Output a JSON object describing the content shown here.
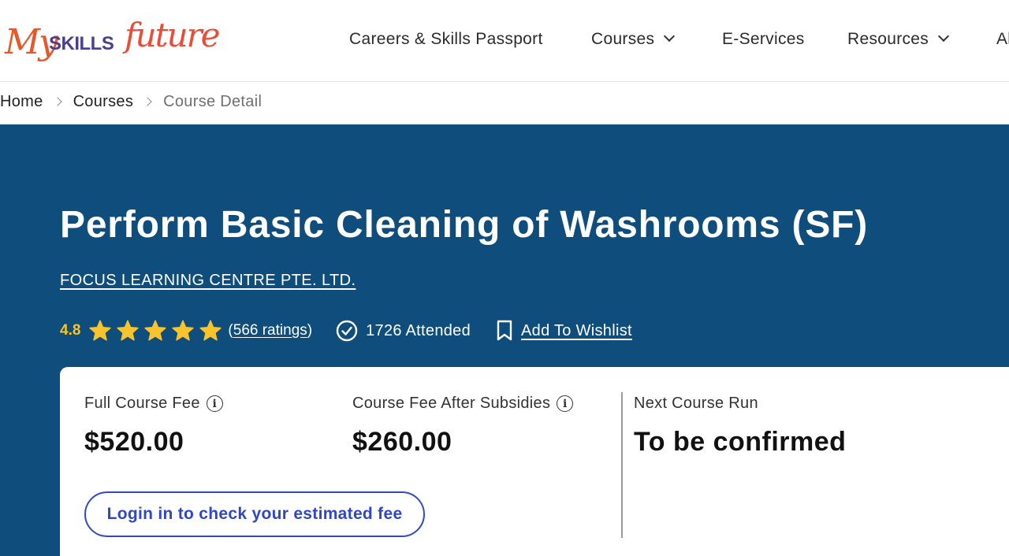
{
  "header": {
    "logo": {
      "my": "My",
      "skills": "SKILLS",
      "future": "future"
    },
    "nav": [
      {
        "label": "Careers & Skills Passport",
        "has_dropdown": false
      },
      {
        "label": "Courses",
        "has_dropdown": true
      },
      {
        "label": "E-Services",
        "has_dropdown": false
      },
      {
        "label": "Resources",
        "has_dropdown": true
      },
      {
        "label": "Al",
        "has_dropdown": false
      }
    ]
  },
  "breadcrumb": [
    "Home",
    "Courses",
    "Course Detail"
  ],
  "course": {
    "title": "Perform Basic Cleaning of Washrooms (SF)",
    "provider": "FOCUS LEARNING CENTRE PTE. LTD.",
    "rating": "4.8",
    "stars": 5,
    "ratings_open": "(",
    "ratings_count": "566 ratings",
    "ratings_close": ")",
    "attended": "1726 Attended",
    "wishlist_label": "Add To Wishlist"
  },
  "fees": {
    "full_label": "Full Course Fee",
    "full_value": "$520.00",
    "subsidised_label": "Course Fee After Subsidies",
    "subsidised_value": "$260.00",
    "next_run_label": "Next Course Run",
    "next_run_value": "To be confirmed",
    "login_button": "Login in to check your estimated fee"
  },
  "colors": {
    "hero_bg": "#0f4e7c",
    "star": "#f8c32b",
    "button_accent": "#3049c9",
    "logo_orange": "#e8572a",
    "logo_purple": "#4a3f8f"
  },
  "icons": {
    "info": "info-icon",
    "attended": "check-circle-icon",
    "wishlist": "bookmark-icon",
    "dropdown": "chevron-down-icon",
    "breadcrumb_sep": "chevron-right-icon",
    "rating": "star-icon"
  }
}
